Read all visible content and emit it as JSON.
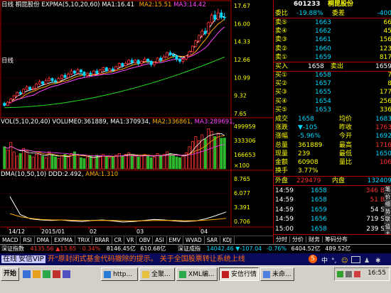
{
  "chart_data": [
    {
      "type": "candlestick",
      "title": "日线  桐昆股份  EXPMA(5,10,20,60)",
      "indicator_labels": [
        {
          "text": "MA1:16.41",
          "color": "#ffffff"
        },
        {
          "text": "MA2:15.51",
          "color": "#ffaa00"
        },
        {
          "text": "MA3:14.42",
          "color": "#ff44ff"
        }
      ],
      "period_label": "日线",
      "y_ticks": [
        "17.67",
        "16.00",
        "14.33",
        "12.66",
        "10.99",
        "9.32",
        "7.65"
      ],
      "ylim": [
        7.65,
        17.67
      ],
      "candles": [
        [
          8.6,
          8.4,
          8.75,
          8.3
        ],
        [
          8.4,
          8.7,
          8.8,
          8.35
        ],
        [
          8.7,
          9.0,
          9.1,
          8.6
        ],
        [
          9.0,
          9.3,
          9.4,
          8.9
        ],
        [
          9.3,
          9.6,
          9.7,
          9.2
        ],
        [
          9.6,
          9.5,
          9.8,
          9.4
        ],
        [
          9.5,
          9.9,
          10.0,
          9.4
        ],
        [
          9.9,
          10.1,
          10.3,
          9.8
        ],
        [
          10.1,
          9.9,
          10.2,
          9.7
        ],
        [
          9.9,
          10.0,
          10.2,
          9.8
        ],
        [
          10.0,
          10.4,
          10.5,
          9.9
        ],
        [
          10.4,
          10.6,
          10.8,
          10.3
        ],
        [
          10.6,
          10.4,
          10.7,
          10.2
        ],
        [
          10.4,
          10.7,
          10.9,
          10.3
        ],
        [
          10.7,
          10.9,
          11.1,
          10.6
        ],
        [
          10.9,
          10.7,
          11.0,
          10.5
        ],
        [
          10.7,
          10.6,
          10.9,
          10.4
        ],
        [
          10.6,
          10.9,
          11.0,
          10.5
        ],
        [
          10.9,
          11.2,
          11.3,
          10.8
        ],
        [
          11.2,
          11.0,
          11.4,
          10.9
        ],
        [
          11.0,
          11.3,
          11.5,
          10.9
        ],
        [
          11.3,
          11.6,
          11.8,
          11.2
        ],
        [
          11.6,
          11.4,
          11.7,
          11.2
        ],
        [
          11.4,
          11.7,
          11.9,
          11.3
        ],
        [
          11.7,
          11.5,
          11.8,
          11.3
        ],
        [
          11.5,
          11.2,
          11.6,
          11.0
        ],
        [
          11.2,
          11.4,
          11.5,
          11.0
        ],
        [
          11.4,
          11.3,
          11.6,
          11.1
        ],
        [
          11.3,
          11.6,
          11.7,
          11.2
        ],
        [
          11.6,
          11.4,
          11.8,
          11.3
        ],
        [
          11.4,
          11.7,
          11.8,
          11.3
        ],
        [
          11.7,
          11.9,
          12.0,
          11.6
        ],
        [
          11.9,
          11.6,
          12.0,
          11.5
        ],
        [
          11.6,
          11.8,
          11.9,
          11.5
        ],
        [
          11.8,
          11.7,
          12.0,
          11.5
        ],
        [
          11.7,
          12.0,
          12.1,
          11.6
        ],
        [
          12.0,
          12.3,
          12.4,
          11.9
        ],
        [
          12.3,
          12.1,
          12.4,
          11.9
        ],
        [
          12.1,
          12.3,
          12.5,
          12.0
        ],
        [
          12.3,
          12.6,
          12.7,
          12.2
        ],
        [
          12.6,
          12.4,
          12.8,
          12.2
        ],
        [
          12.4,
          12.6,
          12.7,
          12.3
        ],
        [
          12.6,
          12.3,
          12.7,
          12.1
        ],
        [
          12.3,
          12.5,
          12.6,
          12.1
        ],
        [
          12.5,
          12.7,
          12.9,
          12.4
        ],
        [
          12.7,
          12.5,
          12.8,
          12.3
        ],
        [
          12.5,
          12.2,
          12.6,
          12.0
        ],
        [
          12.2,
          12.4,
          12.5,
          12.0
        ],
        [
          12.4,
          12.8,
          12.9,
          12.3
        ],
        [
          12.8,
          12.6,
          13.0,
          12.4
        ],
        [
          12.6,
          12.9,
          13.1,
          12.5
        ],
        [
          12.9,
          13.3,
          13.4,
          12.8
        ],
        [
          13.3,
          13.1,
          13.5,
          13.0
        ],
        [
          13.1,
          13.0,
          13.3,
          12.8
        ],
        [
          13.0,
          12.7,
          13.1,
          12.5
        ],
        [
          12.7,
          12.5,
          12.8,
          12.3
        ],
        [
          12.5,
          12.7,
          12.8,
          12.3
        ],
        [
          12.7,
          13.0,
          13.1,
          12.6
        ],
        [
          13.0,
          13.4,
          13.5,
          12.9
        ],
        [
          13.4,
          13.9,
          14.0,
          13.3
        ],
        [
          13.9,
          14.4,
          14.5,
          13.8
        ],
        [
          14.4,
          14.9,
          15.0,
          14.2
        ],
        [
          14.9,
          15.3,
          15.5,
          14.7
        ],
        [
          15.3,
          15.1,
          15.6,
          14.9
        ],
        [
          15.1,
          16.1,
          16.2,
          15.0
        ],
        [
          16.1,
          16.8,
          17.0,
          15.9
        ],
        [
          16.8,
          16.4,
          17.2,
          16.2
        ],
        [
          16.4,
          17.0,
          17.4,
          16.3
        ],
        [
          17.0,
          16.6,
          17.3,
          16.4
        ],
        [
          16.6,
          16.58,
          17.0,
          16.3
        ]
      ],
      "ma_series": [
        {
          "name": "MA1",
          "color": "#ffffff",
          "start": 9.0,
          "end": 16.4
        },
        {
          "name": "MA2",
          "color": "#ffaa00",
          "start": 8.8,
          "end": 15.5
        },
        {
          "name": "MA3",
          "color": "#ff44ff",
          "start": 8.6,
          "end": 14.4
        },
        {
          "color": "#22dd22",
          "start": 8.2,
          "end": 12.9
        }
      ]
    },
    {
      "type": "bar",
      "title": "VOL(5,10,20,40)  VOLUME0:361889,",
      "indicator_labels": [
        {
          "text": "MA1:370934,",
          "color": "#ffffff"
        },
        {
          "text": "MA2:336861,",
          "color": "#ffaa00"
        },
        {
          "text": "MA3:289691,",
          "color": "#ff44ff"
        }
      ],
      "y_ticks": [
        "499959",
        "333306",
        "166653",
        "×100"
      ],
      "ylim": [
        0,
        499959
      ],
      "values": [
        260000,
        220000,
        310000,
        200000,
        150000,
        180000,
        240000,
        210000,
        160000,
        140000,
        170000,
        190000,
        150000,
        130000,
        200000,
        160000,
        140000,
        120000,
        150000,
        170000,
        140000,
        180000,
        200000,
        160000,
        130000,
        120000,
        140000,
        150000,
        130000,
        160000,
        140000,
        170000,
        150000,
        130000,
        140000,
        160000,
        180000,
        150000,
        170000,
        190000,
        160000,
        150000,
        140000,
        160000,
        170000,
        150000,
        130000,
        140000,
        180000,
        160000,
        170000,
        200000,
        180000,
        160000,
        140000,
        130000,
        150000,
        190000,
        260000,
        320000,
        380000,
        330000,
        400000,
        350000,
        470000,
        440000,
        380000,
        420000,
        360000,
        361889
      ]
    },
    {
      "type": "line",
      "title": "DMA(10,50,10)  DDD:2.492,",
      "indicator_labels": [
        {
          "text": "AMA:1.310",
          "color": "#ffaa00"
        }
      ],
      "y_ticks": [
        "8.765",
        "6.077",
        "3.391",
        "0.706"
      ],
      "ylim": [
        0.2,
        8.765
      ],
      "series": [
        {
          "name": "DDD",
          "color": "#ffffff",
          "values": [
            5.4,
            2.0,
            1.2,
            1.0,
            0.9,
            1.0,
            0.8,
            0.7,
            0.9,
            1.0,
            0.8,
            0.6,
            0.7,
            0.9,
            1.1,
            1.0,
            0.8,
            0.7,
            0.8,
            1.2,
            1.8,
            2.5
          ]
        },
        {
          "name": "AMA",
          "color": "#ffaa00",
          "values": [
            2.2,
            1.6,
            1.3,
            1.1,
            1.0,
            1.0,
            0.95,
            0.9,
            0.9,
            0.92,
            0.9,
            0.85,
            0.82,
            0.85,
            0.9,
            0.92,
            0.9,
            0.85,
            0.85,
            0.95,
            1.1,
            1.31
          ]
        }
      ]
    }
  ],
  "x_axis_labels": [
    "14/12",
    "2015/01",
    "02",
    "03",
    "04"
  ],
  "indicator_tabs": [
    "MACD",
    "RSI",
    "DMA",
    "EXPMA",
    "TRIX",
    "BRAR",
    "CR",
    "VR",
    "OBV",
    "ASI",
    "EMV",
    "WVAD",
    "SAR",
    "KDJ"
  ],
  "stock": {
    "code": "601233",
    "name": "桐昆股份"
  },
  "weibi": {
    "label1": "委比",
    "value1": "-19.88%",
    "label2": "委差",
    "value2": "-400"
  },
  "asks": [
    {
      "label": "卖⑤",
      "price": "1663",
      "qty": "66"
    },
    {
      "label": "卖④",
      "price": "1662",
      "qty": "45"
    },
    {
      "label": "卖③",
      "price": "1661",
      "qty": "156"
    },
    {
      "label": "卖②",
      "price": "1660",
      "qty": "123"
    },
    {
      "label": "卖①",
      "price": "1659",
      "qty": "817"
    }
  ],
  "trade_row": {
    "label1": "买入",
    "value1": "1658",
    "label2": "卖出",
    "value2": "1659"
  },
  "bids": [
    {
      "label": "买①",
      "price": "1658",
      "qty": "7"
    },
    {
      "label": "买②",
      "price": "1657",
      "qty": "8"
    },
    {
      "label": "买③",
      "price": "1655",
      "qty": "177"
    },
    {
      "label": "买④",
      "price": "1654",
      "qty": "256"
    },
    {
      "label": "买⑤",
      "price": "1653",
      "qty": "336"
    }
  ],
  "stats": [
    {
      "l1": "成交",
      "v1": "1658",
      "l2": "均价",
      "v2": "1683"
    },
    {
      "l1": "涨跌",
      "v1": "▼-105",
      "l2": "昨收",
      "v2": "1763"
    },
    {
      "l1": "涨幅",
      "v1": "-5.96%",
      "l2": "今开",
      "v2": "1692"
    },
    {
      "l1": "总量",
      "v1": "361889",
      "l2": "最高",
      "v2": "1716"
    },
    {
      "l1": "现量",
      "v1": "239",
      "l2": "最低",
      "v2": "1650"
    },
    {
      "l1": "金额",
      "v1": "60908",
      "l2": "量比",
      "v2": "106"
    },
    {
      "l1": "换手",
      "v1": "3.77%",
      "l2": "",
      "v2": ""
    }
  ],
  "outer_inner": {
    "label1": "外盘",
    "value1": "229479",
    "label2": "内盘",
    "value2": "132409"
  },
  "ticks": [
    {
      "time": "14:59",
      "price": "1658",
      "vol": "346 B"
    },
    {
      "time": "14:59",
      "price": "1658",
      "vol": "51 B"
    },
    {
      "time": "14:59",
      "price": "1659",
      "vol": "54 S"
    },
    {
      "time": "14:59",
      "price": "1656",
      "vol": "719 S"
    },
    {
      "time": "15:00",
      "price": "1658",
      "vol": "239 S"
    }
  ],
  "side_tabs": [
    "笔",
    "价",
    "细",
    "势",
    "联",
    "值",
    "主"
  ],
  "bottom_tabs": [
    "分时",
    "分价",
    "财务",
    "筹码分布"
  ],
  "index_bar": {
    "name": "深证指数",
    "value": "4135.56",
    "change": "▲13.85",
    "pct": "0.34%",
    "amount": "8146.45亿",
    "extra": "610.68亿",
    "name2": "深证成指",
    "value2": "14042.46",
    "change2": "▼-107.04",
    "pct2": "-0.76%",
    "amount2": "6404.52亿",
    "extra2": "489.52亿"
  },
  "news": {
    "prefix": "在线",
    "source": "安信VIP",
    "text": "开\"原封闭式基金代码撤除的提示。    关于全国股票转让系统上线"
  },
  "taskbar": {
    "start": "开始",
    "buttons": [
      "http...",
      "全聚...",
      "XML编...",
      "安信行情",
      "未命..."
    ],
    "clock": "16:55"
  },
  "colors": {
    "up": "#ff3232",
    "down": "#00d7ff",
    "grid": "#8b0000",
    "axis": "#b40000",
    "label": "#ffff00"
  }
}
